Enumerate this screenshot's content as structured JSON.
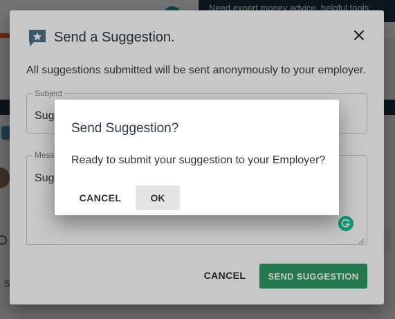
{
  "background": {
    "topbar_text": "Need expert money advice, helpful tools",
    "left_snippet": "S"
  },
  "dialog": {
    "title": "Send a Suggestion.",
    "description": "All suggestions submitted will be sent anonymously to your employer.",
    "subject": {
      "label": "Subject",
      "value": "Sugg"
    },
    "message": {
      "label": "Mess",
      "value": "Sugg"
    },
    "cancel_label": "CANCEL",
    "send_label": "SEND SUGGESTION",
    "icons": {
      "title": "star-speech-bubble-icon",
      "close": "close-icon",
      "grammarly": "grammarly-icon"
    },
    "colors": {
      "primary": "#2e9a65",
      "title_text": "#2b3a45"
    }
  },
  "confirm": {
    "title": "Send Suggestion?",
    "body": "Ready to submit your suggestion to your Employer?",
    "cancel_label": "CANCEL",
    "ok_label": "OK"
  }
}
